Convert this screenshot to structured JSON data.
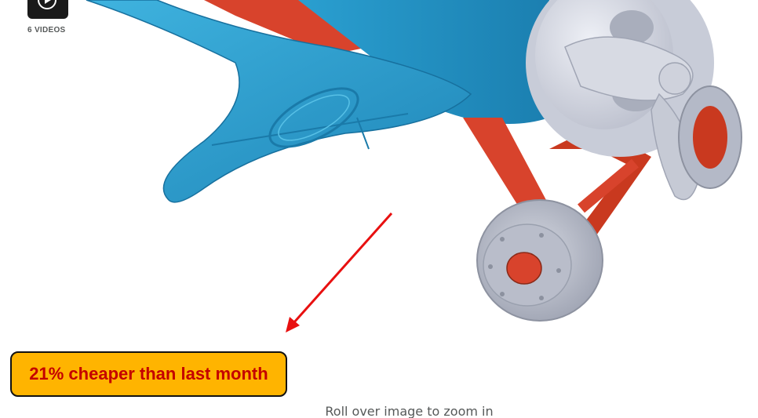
{
  "media": {
    "video_count_label": "6 VIDEOS",
    "video_thumb_icon": "play-icon",
    "product_image_alt": "product-image-toy-airplane",
    "colors": {
      "plane_body": "#2a9fd0",
      "plane_frame": "#e0402a",
      "propeller": "#c9ccd6",
      "wheel": "#b7bcc9"
    }
  },
  "annotation": {
    "arrow_color": "#e81010",
    "deal_text": "21% cheaper than last month",
    "deal_bg": "#ffb400",
    "deal_text_color": "#c40000"
  },
  "footer": {
    "zoom_hint": "Roll over image to zoom in"
  }
}
